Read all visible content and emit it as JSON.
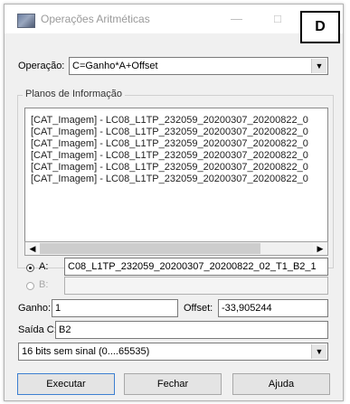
{
  "window": {
    "title": "Operações Aritméticas",
    "minimize_glyph": "—",
    "maximize_glyph": "□"
  },
  "badge": {
    "label": "D"
  },
  "operacao": {
    "label": "Operação:",
    "value": "C=Ganho*A+Offset",
    "arrow": "▼"
  },
  "planos": {
    "title": "Planos de Informação",
    "items": [
      "[CAT_Imagem] - LC08_L1TP_232059_20200307_20200822_0",
      "[CAT_Imagem] - LC08_L1TP_232059_20200307_20200822_0",
      "[CAT_Imagem] - LC08_L1TP_232059_20200307_20200822_0",
      "[CAT_Imagem] - LC08_L1TP_232059_20200307_20200822_0",
      "[CAT_Imagem] - LC08_L1TP_232059_20200307_20200822_0",
      "[CAT_Imagem] - LC08_L1TP_232059_20200307_20200822_0"
    ],
    "scroll_left": "◀",
    "scroll_right": "▶"
  },
  "inputs": {
    "a_label": "A:",
    "a_value": "C08_L1TP_232059_20200307_20200822_02_T1_B2_1",
    "a_selected": true,
    "b_label": "B:",
    "b_value": "",
    "b_selected": false
  },
  "ganho": {
    "label": "Ganho:",
    "value": "1"
  },
  "offset": {
    "label": "Offset:",
    "value": "-33,905244"
  },
  "saida": {
    "label": "Saída C:",
    "value": "B2"
  },
  "tipo": {
    "value": "16 bits sem sinal (0....65535)",
    "arrow": "▼"
  },
  "buttons": {
    "executar": "Executar",
    "fechar": "Fechar",
    "ajuda": "Ajuda"
  }
}
